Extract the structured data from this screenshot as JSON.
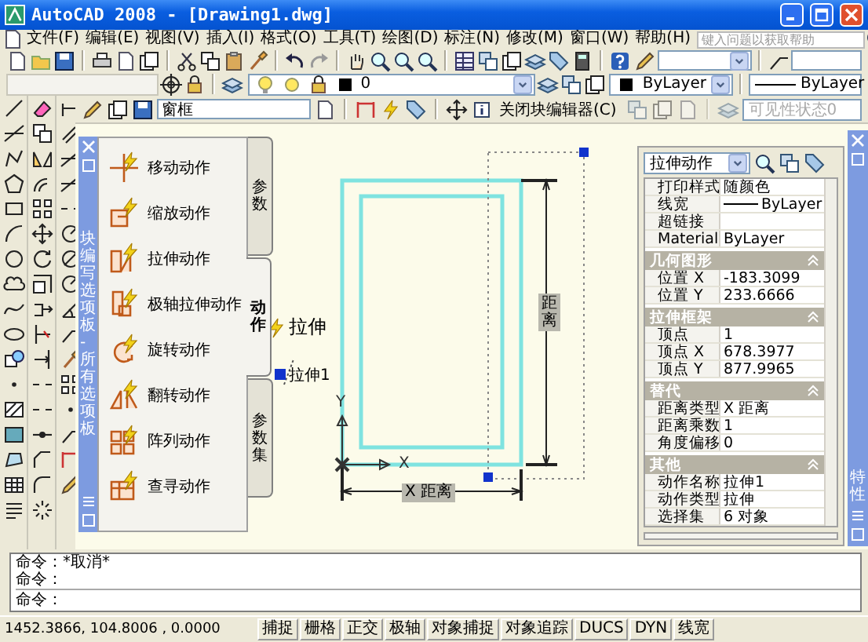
{
  "window": {
    "title": "AutoCAD 2008 - [Drawing1.dwg]"
  },
  "menu_bar": {
    "items": [
      "文件(F)",
      "编辑(E)",
      "视图(V)",
      "插入(I)",
      "格式(O)",
      "工具(T)",
      "绘图(D)",
      "标注(N)",
      "修改(M)",
      "窗口(W)",
      "帮助(H)"
    ],
    "help_search": {
      "placeholder": "键入问题以获取帮助"
    }
  },
  "layers_toolbar": {
    "layer": "0",
    "color_setting": "ByLayer",
    "linetype": "ByLayer"
  },
  "block_editor_toolbar": {
    "block_name": "窗框",
    "close_button": "关闭块编辑器(C)",
    "visibility_state": {
      "value": "可见性状态0",
      "disabled": true
    }
  },
  "palette": {
    "title": "块编写选项板 - 所有选项板",
    "tabs": [
      {
        "label": "参数",
        "selected": false
      },
      {
        "label": "动作",
        "selected": true
      },
      {
        "label": "参数集",
        "selected": false
      }
    ],
    "items": [
      "移动动作",
      "缩放动作",
      "拉伸动作",
      "极轴拉伸动作",
      "旋转动作",
      "翻转动作",
      "阵列动作",
      "查寻动作"
    ]
  },
  "canvas": {
    "action_label": "拉伸",
    "parameter_label": "拉伸1",
    "dimension_vertical": "距离",
    "dimension_horizontal": "X 距离",
    "axis_x": "X",
    "axis_y": "Y"
  },
  "properties": {
    "title": "特性",
    "selector": "拉伸动作",
    "sections": [
      {
        "rows": [
          {
            "kind": "text",
            "label": "打印样式",
            "value": "随颜色"
          },
          {
            "kind": "lineweight",
            "label": "线宽",
            "value": "ByLayer"
          },
          {
            "kind": "text",
            "label": "超链接"
          },
          {
            "kind": "text",
            "label": "Material",
            "value": "ByLayer"
          }
        ]
      },
      {
        "title": "几何图形",
        "rows": [
          {
            "kind": "text",
            "label": "位置 X",
            "value": "-183.3099"
          },
          {
            "kind": "text",
            "label": "位置 Y",
            "value": "233.6666"
          }
        ]
      },
      {
        "title": "拉伸框架",
        "rows": [
          {
            "kind": "text",
            "label": "顶点",
            "value": "1"
          },
          {
            "kind": "text",
            "label": "顶点 X",
            "value": "678.3977"
          },
          {
            "kind": "text",
            "label": "顶点 Y",
            "value": "877.9965"
          }
        ]
      },
      {
        "title": "替代",
        "rows": [
          {
            "kind": "text",
            "label": "距离类型",
            "value": "X 距离"
          },
          {
            "kind": "text",
            "label": "距离乘数",
            "value": "1"
          },
          {
            "kind": "text",
            "label": "角度偏移",
            "value": "0"
          }
        ]
      },
      {
        "title": "其他",
        "rows": [
          {
            "kind": "text",
            "label": "动作名称",
            "value": "拉伸1"
          },
          {
            "kind": "text",
            "label": "动作类型",
            "value": "拉伸"
          },
          {
            "kind": "text",
            "label": "选择集",
            "value": "6 对象"
          }
        ]
      }
    ]
  },
  "command_line": {
    "history": [
      "命令：*取消*",
      "命令："
    ],
    "prompt": "命令："
  },
  "status_bar": {
    "coordinates": "1452.3866, 104.8006 , 0.0000",
    "buttons": [
      "捕捉",
      "栅格",
      "正交",
      "极轴",
      "对象捕捉",
      "对象追踪",
      "DUCS",
      "DYN",
      "线宽"
    ]
  }
}
